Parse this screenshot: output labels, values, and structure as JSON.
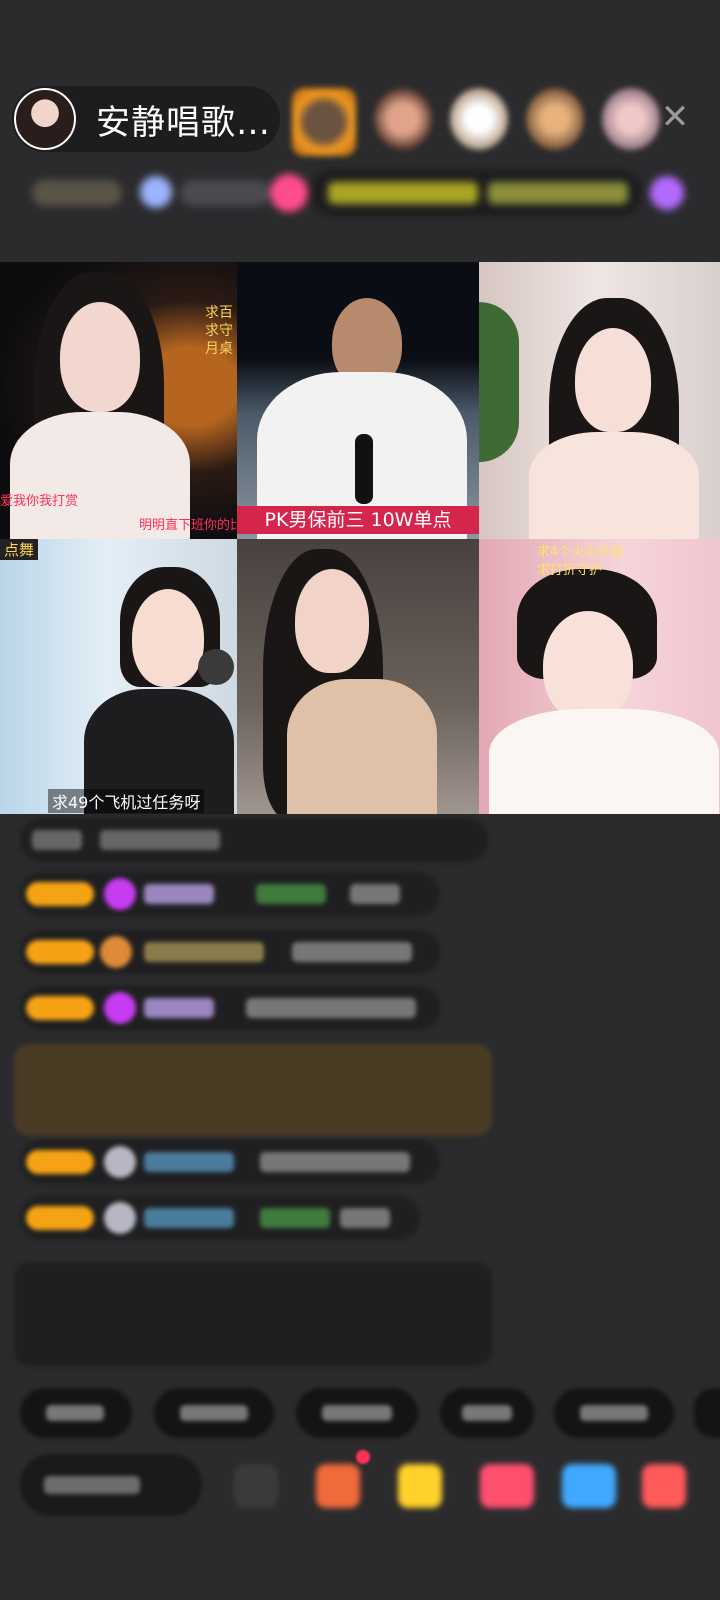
{
  "header": {
    "host_name": "安静唱歌…",
    "close_icon": "close-icon"
  },
  "video_grid": {
    "tiles": [
      {
        "top_right_caption": "求百\n求守\n月桌",
        "bottom_left_caption": "爱我你我打赏",
        "bottom_right_caption": "明明直下班你的比"
      },
      {
        "bottom_caption": "PK男保前三 10W单点"
      },
      {},
      {
        "top_left_caption": "点舞",
        "bottom_caption": "求49个飞机过任务呀"
      },
      {},
      {
        "top_caption_1": "求4个火山升级",
        "top_caption_2": "求打折守护"
      }
    ]
  },
  "colors": {
    "background": "#2b2b2d",
    "badge": "#f5a314",
    "caption_red": "#ff2f5a",
    "caption_yellow": "#ffe26a",
    "caption_pink_bg": "#d4264c"
  }
}
